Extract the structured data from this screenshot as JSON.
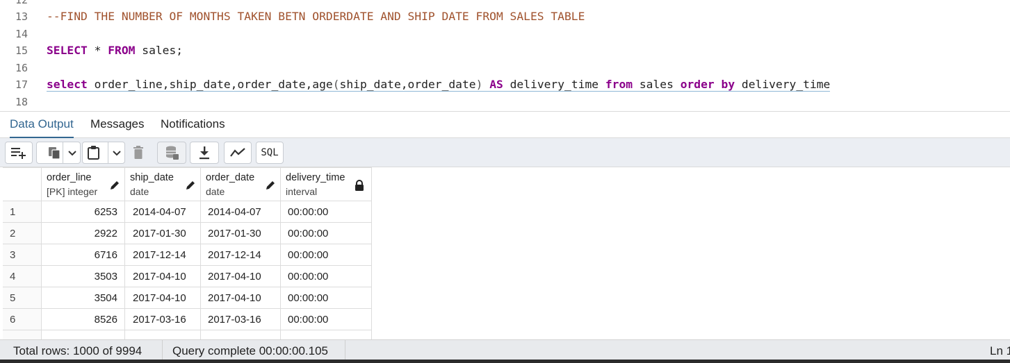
{
  "editor": {
    "lines": [
      {
        "num": "12",
        "text": ""
      },
      {
        "num": "13",
        "text": "--FIND THE NUMBER OF MONTHS TAKEN BETN ORDERDATE AND SHIP DATE FROM SALES TABLE"
      },
      {
        "num": "14",
        "text": ""
      },
      {
        "num": "15",
        "kw1": "SELECT",
        "mid": " * ",
        "kw2": "FROM",
        "rest": " sales;"
      },
      {
        "num": "16",
        "text": ""
      },
      {
        "num": "17",
        "s1": "select",
        "s2": " order_line,ship_date,order_date,age",
        "s3": "(",
        "s4": "ship_date,order_date",
        "s5": ")",
        "s6": " ",
        "s7": "AS",
        "s8": " delivery_time ",
        "s9": "from",
        "s10": " sales ",
        "s11": "order by",
        "s12": " delivery_time"
      },
      {
        "num": "18",
        "text": ""
      }
    ]
  },
  "tabs": {
    "data_output": "Data Output",
    "messages": "Messages",
    "notifications": "Notifications"
  },
  "toolbar": {
    "sql_label": "SQL",
    "icons": [
      "add-row-icon",
      "copy-icon",
      "chevron-down-icon",
      "paste-icon",
      "chevron-down-icon",
      "delete-icon",
      "save-data-icon",
      "download-icon",
      "graph-icon",
      "sql-icon"
    ]
  },
  "grid": {
    "columns": [
      {
        "name": "order_line",
        "type": "[PK] integer",
        "editable": true
      },
      {
        "name": "ship_date",
        "type": "date",
        "editable": true
      },
      {
        "name": "order_date",
        "type": "date",
        "editable": true
      },
      {
        "name": "delivery_time",
        "type": "interval",
        "editable": false
      }
    ],
    "rows": [
      {
        "n": "1",
        "order_line": "6253",
        "ship_date": "2014-04-07",
        "order_date": "2014-04-07",
        "delivery_time": "00:00:00"
      },
      {
        "n": "2",
        "order_line": "2922",
        "ship_date": "2017-01-30",
        "order_date": "2017-01-30",
        "delivery_time": "00:00:00"
      },
      {
        "n": "3",
        "order_line": "6716",
        "ship_date": "2017-12-14",
        "order_date": "2017-12-14",
        "delivery_time": "00:00:00"
      },
      {
        "n": "4",
        "order_line": "3503",
        "ship_date": "2017-04-10",
        "order_date": "2017-04-10",
        "delivery_time": "00:00:00"
      },
      {
        "n": "5",
        "order_line": "3504",
        "ship_date": "2017-04-10",
        "order_date": "2017-04-10",
        "delivery_time": "00:00:00"
      },
      {
        "n": "6",
        "order_line": "8526",
        "ship_date": "2017-03-16",
        "order_date": "2017-03-16",
        "delivery_time": "00:00:00"
      }
    ]
  },
  "status": {
    "total_rows": "Total rows: 1000 of 9994",
    "query": "Query complete 00:00:00.105",
    "ln": "Ln 1"
  },
  "colors": {
    "keyword": "#8b008b",
    "comment": "#a0522d",
    "accent": "#326690"
  }
}
